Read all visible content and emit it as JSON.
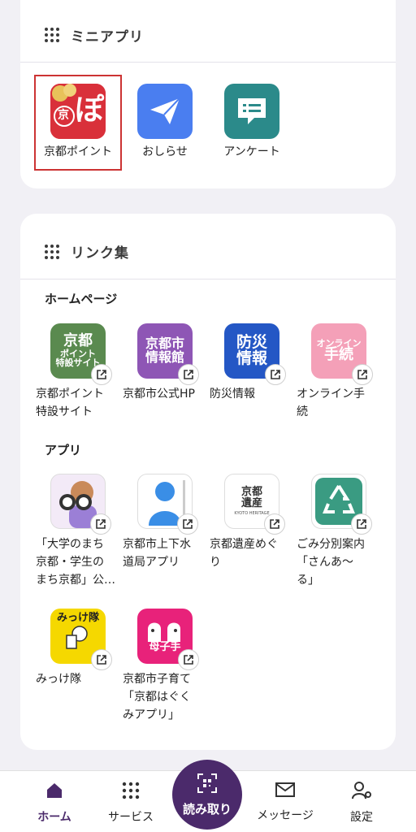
{
  "mini_apps": {
    "title": "ミニアプリ",
    "items": [
      {
        "label": "京都ポイント",
        "icon": "kyoto-point-icon",
        "icon_text_a": "京",
        "icon_text_b": "ぽ",
        "color": "#d9303a"
      },
      {
        "label": "おしらせ",
        "icon": "paper-plane-icon",
        "color": "#4a7ef0"
      },
      {
        "label": "アンケート",
        "icon": "survey-chat-icon",
        "color": "#2b8a8a"
      }
    ]
  },
  "links": {
    "title": "リンク集",
    "homepage_section": "ホームページ",
    "homepage_items": [
      {
        "label_1": "京都ポイント",
        "label_2": "特設サイト",
        "icon_text_1": "京都",
        "icon_text_2": "ポイント",
        "icon_text_3": "特設サイト",
        "color": "#5a8a4f"
      },
      {
        "label_1": "京都市公式HP",
        "label_2": "",
        "icon_text_1": "京都市",
        "icon_text_2": "情報館",
        "color": "#8e56b5"
      },
      {
        "label_1": "防災情報",
        "label_2": "",
        "icon_text_1": "防災",
        "icon_text_2": "情報",
        "color": "#2457c5"
      },
      {
        "label_1": "オンライン手",
        "label_2": "続",
        "icon_text_1": "オンライン",
        "icon_text_2": "手続",
        "color": "#f4a0b8"
      }
    ],
    "apps_section": "アプリ",
    "app_items": [
      {
        "label_1": "「大学のまち",
        "label_2": "京都・学生の",
        "label_3": "まち京都」公…",
        "icon": "binoculars-person-icon"
      },
      {
        "label_1": "京都市上下水",
        "label_2": "道局アプリ",
        "label_3": "",
        "icon": "water-person-silhouette-icon"
      },
      {
        "label_1": "京都遺産めぐ",
        "label_2": "り",
        "label_3": "",
        "icon_text_1": "京都",
        "icon_text_2": "遺産",
        "icon_text_3": "KYOTO HERITAGE"
      },
      {
        "label_1": "ごみ分別案内",
        "label_2": "「さんあ～",
        "label_3": "る」",
        "icon": "recycle-icon"
      },
      {
        "label_1": "みっけ隊",
        "label_2": "",
        "label_3": "",
        "icon_text_1": "みっけ隊"
      },
      {
        "label_1": "京都市子育て",
        "label_2": "「京都はぐく",
        "label_3": "みアプリ」",
        "icon_text_1": "母子手"
      }
    ]
  },
  "bottom_nav": {
    "home": "ホーム",
    "services": "サービス",
    "scan": "読み取り",
    "messages": "メッセージ",
    "settings": "設定"
  },
  "colors": {
    "accent": "#4b2a6b",
    "selection": "#cc3333"
  }
}
